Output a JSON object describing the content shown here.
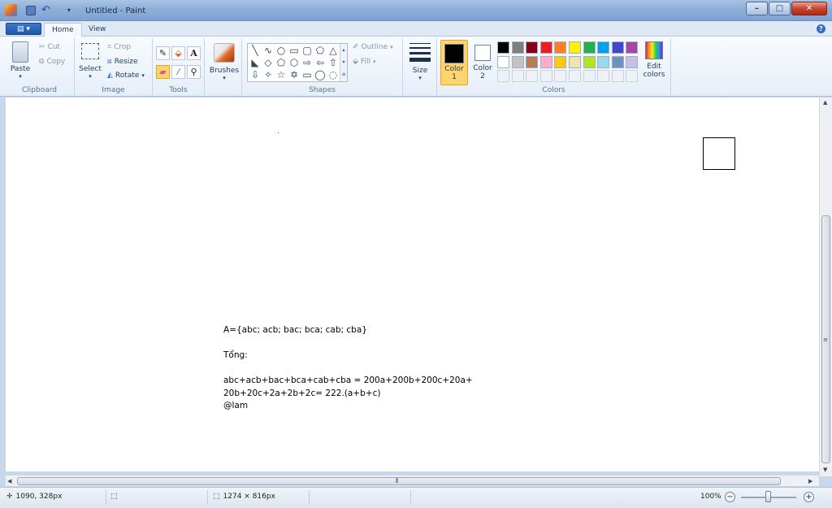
{
  "window": {
    "title": "Untitled - Paint",
    "min": "–",
    "max": "□",
    "close": "✕"
  },
  "tabs": {
    "menu": "▤ ▾",
    "home": "Home",
    "view": "View",
    "help": "?"
  },
  "clipboard": {
    "label": "Clipboard",
    "paste": "Paste",
    "cut": "Cut",
    "copy": "Copy"
  },
  "image": {
    "label": "Image",
    "select": "Select",
    "crop": "Crop",
    "resize": "Resize",
    "rotate": "Rotate"
  },
  "tools": {
    "label": "Tools",
    "text_glyph": "A"
  },
  "brushes": {
    "label": "Brushes"
  },
  "shapes": {
    "label": "Shapes",
    "outline": "Outline",
    "fill": "Fill",
    "glyphs": [
      "╲",
      "∿",
      "○",
      "▭",
      "▢",
      "⬠",
      "△",
      "◣",
      "◇",
      "⬠",
      "⬡",
      "⇨",
      "⇦",
      "⇧",
      "⇩",
      "✧",
      "☆",
      "✡",
      "▭",
      "◯",
      "◌"
    ]
  },
  "size": {
    "label": "Size"
  },
  "colors": {
    "label": "Colors",
    "color1": "Color\n1",
    "color2": "Color\n2",
    "edit": "Edit\ncolors",
    "color1_value": "#000000",
    "color2_value": "#ffffff",
    "palette_row1": [
      "#000000",
      "#7f7f7f",
      "#880015",
      "#ed1c24",
      "#ff7f27",
      "#fff200",
      "#22b14c",
      "#00a2e8",
      "#3f48cc",
      "#a349a4"
    ],
    "palette_row2": [
      "#ffffff",
      "#c3c3c3",
      "#b97a57",
      "#ffaec9",
      "#ffc90e",
      "#efe4b0",
      "#b5e61d",
      "#99d9ea",
      "#7092be",
      "#c8bfe7"
    ]
  },
  "canvas": {
    "text": "A={abc; acb; bac; bca; cab; cba}\n\nTổng:\n\nabc+acb+bac+bca+cab+cba = 200a+200b+200c+20a+\n20b+20c+2a+2b+2c= 222.(a+b+c)\n@lam"
  },
  "status": {
    "cursor": "1090, 328px",
    "size": "1274 × 816px",
    "zoom": "100%",
    "zoom_out": "−",
    "zoom_in": "+"
  }
}
